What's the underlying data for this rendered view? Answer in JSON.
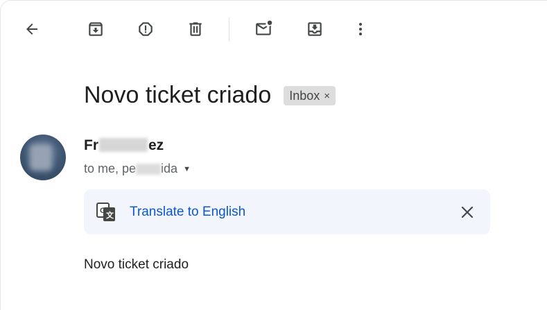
{
  "toolbar": {
    "buttons": [
      {
        "icon": "back-arrow-icon"
      },
      {
        "icon": "archive-icon"
      },
      {
        "icon": "report-spam-icon"
      },
      {
        "icon": "delete-icon"
      },
      {
        "icon": "mark-unread-icon"
      },
      {
        "icon": "move-to-inbox-icon"
      },
      {
        "icon": "more-vertical-icon"
      }
    ]
  },
  "email": {
    "subject": "Novo ticket criado",
    "label": "Inbox",
    "label_close": "×",
    "sender": {
      "name_start": "Fr",
      "name_end": "ez"
    },
    "recipients": {
      "prefix": "to me, pe",
      "suffix": "ida"
    },
    "body": "Novo ticket criado"
  },
  "translate": {
    "link_text": "Translate to English"
  },
  "colors": {
    "link": "#0b57d0",
    "translate_bg": "#f2f6fc",
    "chip_bg": "#dddddd"
  }
}
